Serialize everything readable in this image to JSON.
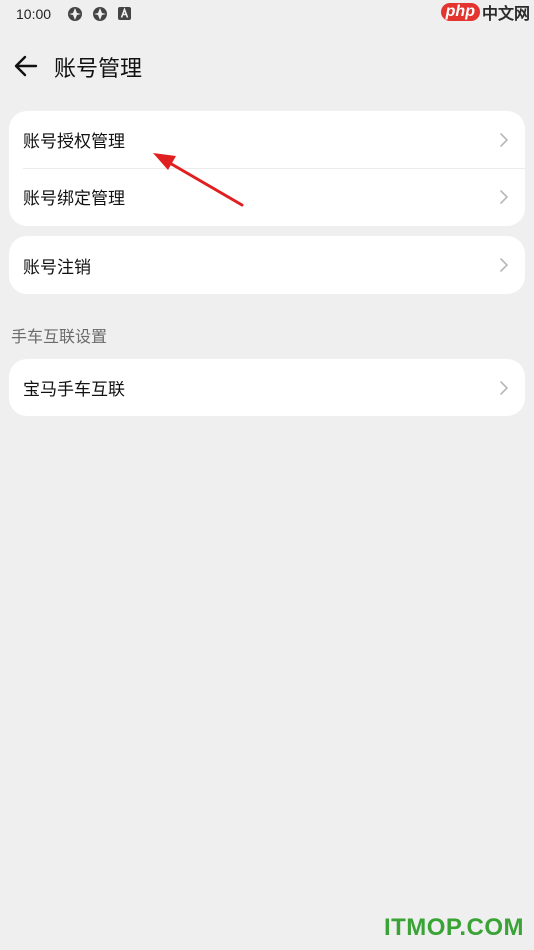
{
  "status_bar": {
    "time": "10:00",
    "icons": [
      "app-icon",
      "app-icon",
      "a-notification-icon"
    ],
    "right_icons": [
      "wifi-icon",
      "signal-icon",
      "battery-icon"
    ]
  },
  "watermark_top": {
    "php": "php",
    "cn": "中文网"
  },
  "header": {
    "back_icon": "back-arrow-icon",
    "title": "账号管理"
  },
  "cards": [
    {
      "items": [
        {
          "label": "账号授权管理"
        },
        {
          "label": "账号绑定管理"
        }
      ]
    },
    {
      "items": [
        {
          "label": "账号注销"
        }
      ]
    }
  ],
  "section": {
    "title": "手车互联设置"
  },
  "section_card": {
    "items": [
      {
        "label": "宝马手车互联"
      }
    ]
  },
  "annotation": {
    "color": "#e02020"
  },
  "watermark_bottom": "ITMOP.COM",
  "colors": {
    "background": "#efefef",
    "card": "#ffffff",
    "chevron": "#b8b8b8",
    "section_text": "#6b6b6b"
  }
}
